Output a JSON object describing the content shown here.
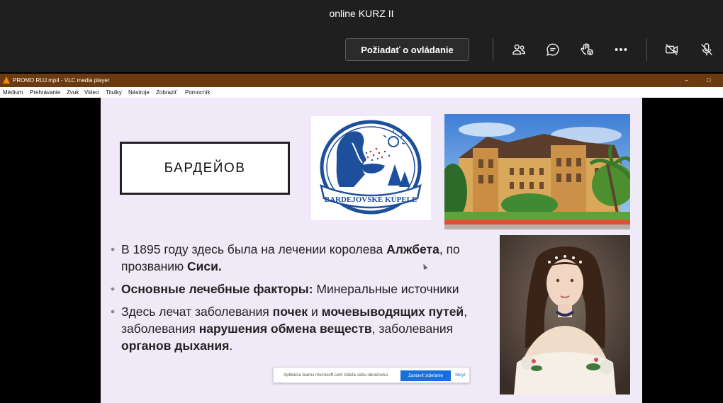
{
  "teams": {
    "title": "online KURZ II",
    "request_control_label": "Požiadať o ovládanie",
    "toolbar_icons": [
      "people-icon",
      "chat-icon",
      "raise-hand-icon",
      "more-icon",
      "camera-off-icon",
      "mic-off-icon"
    ]
  },
  "vlc": {
    "window_title": "PROMO RUJ.mp4 - VLC media player",
    "menu": [
      "Médium",
      "Prehrávanie",
      "Zvuk",
      "Video",
      "Titulky",
      "Nástroje",
      "Zobraziť",
      "Pomocník"
    ]
  },
  "slide": {
    "title": "БАРДЕЙОВ",
    "logo_text": "BARDEJOVSKÉ KÚPELE",
    "bullets": [
      {
        "parts": [
          {
            "t": "В 1895 году здесь была на лечении королева ",
            "b": false
          },
          {
            "t": "Алжбета",
            "b": true
          },
          {
            "t": ", по прозванию ",
            "b": false
          },
          {
            "t": "Сиси.",
            "b": true
          }
        ]
      },
      {
        "parts": [
          {
            "t": "Основные лечебные факторы:",
            "b": true
          },
          {
            "t": " Минеральные источники",
            "b": false
          }
        ]
      },
      {
        "parts": [
          {
            "t": "Здесь лечат заболевания ",
            "b": false
          },
          {
            "t": "почек",
            "b": true
          },
          {
            "t": " и ",
            "b": false
          },
          {
            "t": "мочевыводящих путей",
            "b": true
          },
          {
            "t": ", заболевания ",
            "b": false
          },
          {
            "t": "нарушения обмена веществ",
            "b": true
          },
          {
            "t": ", заболевания ",
            "b": false
          },
          {
            "t": "органов дыхания",
            "b": true
          },
          {
            "t": ".",
            "b": false
          }
        ]
      }
    ]
  },
  "share_bar": {
    "message": "Aplikácia teams.microsoft.com zdieľa vašu obrazovku.",
    "stop_label": "Zastaviť zdieľanie",
    "hide_label": "Skryť"
  },
  "colors": {
    "teams_bg": "#1f1f1f",
    "vlc_titlebar": "#6b3a10",
    "slide_bg": "#efe9f8",
    "logo_blue": "#1d4f9c",
    "share_button": "#1a6fe0"
  }
}
